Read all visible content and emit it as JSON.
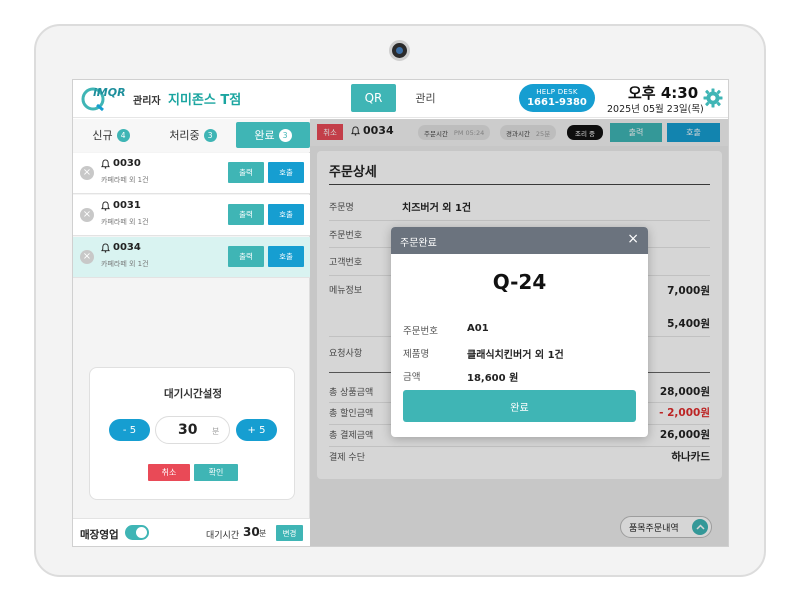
{
  "header": {
    "logo_text": "iMQR",
    "role": "관리자",
    "store_name": "지미존스 T점",
    "tabs": [
      "QR",
      "관리"
    ],
    "helpdesk_title": "HELP DESK",
    "helpdesk_phone": "1661-9380",
    "time": "오후 4:30",
    "date": "2025년 05월 23일(목)"
  },
  "left_tabs": [
    {
      "label": "신규",
      "count": "4"
    },
    {
      "label": "처리중",
      "count": "3"
    },
    {
      "label": "완료",
      "count": "3"
    }
  ],
  "orders": [
    {
      "no": "0030",
      "sub": "카페라떼 외 1건",
      "print": "출력",
      "call": "호출"
    },
    {
      "no": "0031",
      "sub": "카페라떼 외 1건",
      "print": "출력",
      "call": "호출"
    },
    {
      "no": "0034",
      "sub": "카페라떼 외 1건",
      "print": "출력",
      "call": "호출"
    }
  ],
  "wait_setting": {
    "title": "대기시간설정",
    "minus": "- 5",
    "plus": "+ 5",
    "value": "30",
    "unit": "분",
    "cancel": "취소",
    "confirm": "확인"
  },
  "footer": {
    "business_label": "매장영업",
    "wait_label": "대기시간",
    "wait_value": "30",
    "wait_unit": "분",
    "change": "변경"
  },
  "topbar": {
    "cancel": "취소",
    "order_no": "0034",
    "order_time_label": "주문시간",
    "order_time": "PM 05:24",
    "elapsed_label": "경과시간",
    "elapsed": "25분",
    "status": "조리 중",
    "print": "출력",
    "call": "호출"
  },
  "detail": {
    "title": "주문상세",
    "rows": [
      {
        "label": "주문명",
        "value": "치즈버거 외 1건"
      },
      {
        "label": "주문번호",
        "value": ""
      },
      {
        "label": "고객번호",
        "value": ""
      },
      {
        "label": "메뉴정보",
        "value": ""
      }
    ],
    "menu_amounts": [
      "7,000원",
      "5,400원"
    ],
    "request_label": "요청사항",
    "totals": [
      {
        "label": "총 상품금액",
        "value": "28,000원"
      },
      {
        "label": "총 할인금액",
        "value": "- 2,000원"
      },
      {
        "label": "총 결제금액",
        "value": "26,000원"
      },
      {
        "label": "결제 수단",
        "value": "하나카드"
      }
    ],
    "item_order_button": "품목주문내역"
  },
  "modal": {
    "title": "주문완료",
    "code": "Q-24",
    "order_no_label": "주문번호",
    "order_no": "A01",
    "product_label": "제품명",
    "product": "클래식치킨버거 외 1건",
    "amount_label": "금액",
    "amount": "18,600 원",
    "button": "완료"
  },
  "colors": {
    "accent_teal": "#3fb5b5",
    "accent_blue": "#169ed1",
    "danger": "#e94a57"
  }
}
